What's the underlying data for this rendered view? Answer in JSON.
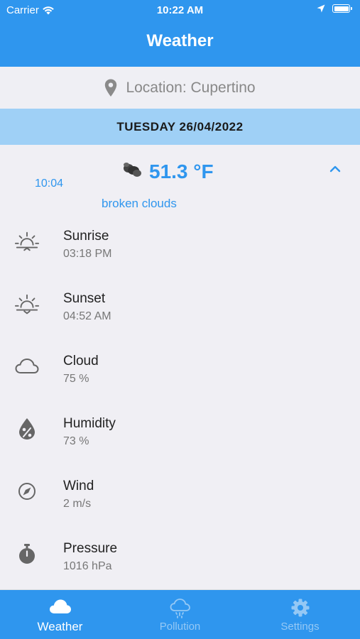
{
  "status_bar": {
    "carrier": "Carrier",
    "time": "10:22 AM",
    "battery_level": 1.0
  },
  "header": {
    "title": "Weather"
  },
  "location": {
    "text": "Location: Cupertino",
    "icon": "map-pin-icon"
  },
  "date": {
    "text": "TUESDAY 26/04/2022"
  },
  "current": {
    "time": "10:04",
    "temperature": "51.3 °F",
    "description": "broken clouds",
    "icon": "broken-clouds-icon"
  },
  "details": [
    {
      "label": "Sunrise",
      "value": "03:18 PM",
      "icon": "sunrise-icon"
    },
    {
      "label": "Sunset",
      "value": "04:52 AM",
      "icon": "sunset-icon"
    },
    {
      "label": "Cloud",
      "value": "75 %",
      "icon": "cloud-icon"
    },
    {
      "label": "Humidity",
      "value": "73 %",
      "icon": "humidity-icon"
    },
    {
      "label": "Wind",
      "value": "2 m/s",
      "icon": "compass-icon"
    },
    {
      "label": "Pressure",
      "value": "1016 hPa",
      "icon": "stopwatch-icon"
    }
  ],
  "tabs": [
    {
      "label": "Weather",
      "icon": "cloud-icon",
      "active": true
    },
    {
      "label": "Pollution",
      "icon": "pollution-cloud-icon",
      "active": false
    },
    {
      "label": "Settings",
      "icon": "gear-icon",
      "active": false
    }
  ],
  "colors": {
    "accent": "#2f96ee",
    "date_bar": "#9fd0f6",
    "background": "#f0eff4",
    "inactive_tab": "#94c8f5"
  }
}
